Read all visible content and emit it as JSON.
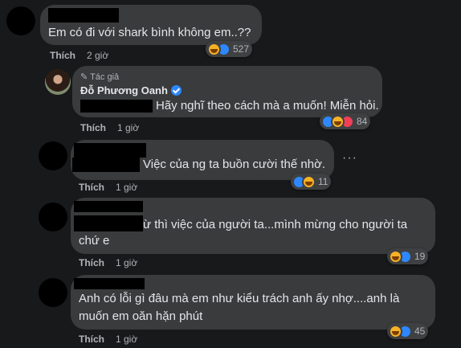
{
  "comments": [
    {
      "text": "Em có đi với shark bình không em..??",
      "like": "Thích",
      "time": "2 giờ",
      "reaction_count": "527"
    },
    {
      "badge": "Tác giả",
      "author": "Đỗ Phương Oanh",
      "text": "Hãy nghĩ theo cách mà a muốn! Miễn hỏi.",
      "like": "Thích",
      "time": "1 giờ",
      "reaction_count": "84"
    },
    {
      "text": "Việc của ng ta buồn cười thế nhờ.",
      "like": "Thích",
      "time": "1 giờ",
      "reaction_count": "11",
      "more": "···"
    },
    {
      "text_line1": "ừ thì việc của người ta...mình mừng cho người ta",
      "text_line2": "chứ e",
      "like": "Thích",
      "time": "1 giờ",
      "reaction_count": "19"
    },
    {
      "text_line1": "Anh có lỗi gì đâu mà em như kiểu trách anh ấy nhợ....anh là",
      "text_line2": "muốn em oăn hặn phút",
      "like": "Thích",
      "time": "1 giờ",
      "reaction_count": "45"
    }
  ],
  "colors": {
    "background": "#18191a",
    "bubble": "#3a3b3c",
    "like_blue": "#2d88ff",
    "haha_yellow": "#f7b125",
    "love_red": "#f33e58"
  },
  "icons": [
    "like-reaction-icon",
    "haha-reaction-icon",
    "love-reaction-icon",
    "verified-badge-icon",
    "pencil-icon",
    "more-options-icon"
  ]
}
